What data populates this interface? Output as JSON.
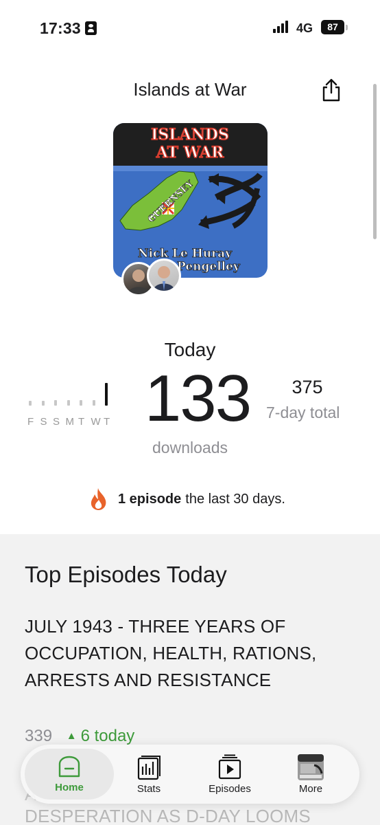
{
  "status_bar": {
    "time": "17:33",
    "network": "4G",
    "battery": "87"
  },
  "header": {
    "title": "Islands at War"
  },
  "cover": {
    "title_line1": "ISLANDS",
    "title_line2": "AT WAR",
    "island_label": "GUERNSEY",
    "host_line1": "Nick Le Huray",
    "host_line2": "Pengelley"
  },
  "stats": {
    "today_label": "Today",
    "today_downloads": "133",
    "downloads_label": "downloads",
    "week_total": "375",
    "week_total_label": "7-day total",
    "days": [
      "F",
      "S",
      "S",
      "M",
      "T",
      "W",
      "T"
    ],
    "spark_relative_levels": [
      0.12,
      0.12,
      0.14,
      0.14,
      0.14,
      0.14,
      0.55
    ]
  },
  "streak": {
    "count_label": "1 episode",
    "rest_label": "the last 30 days."
  },
  "top_episodes": {
    "section_title": "Top Episodes Today",
    "first": {
      "title": "JULY 1943 - THREE YEARS OF OCCUPATION, HEALTH, RATIONS, ARRESTS AND RESISTANCE",
      "downloads": "339",
      "today_delta": "6 today"
    },
    "next_letter": "A",
    "next_partial": "DESPERATION AS D-DAY LOOMS"
  },
  "tabbar": {
    "home": "Home",
    "stats": "Stats",
    "episodes": "Episodes",
    "more": "More"
  },
  "colors": {
    "accent_green": "#3d9a3a",
    "flame_orange": "#e8632b",
    "cover_blue": "#3d6fc4"
  }
}
